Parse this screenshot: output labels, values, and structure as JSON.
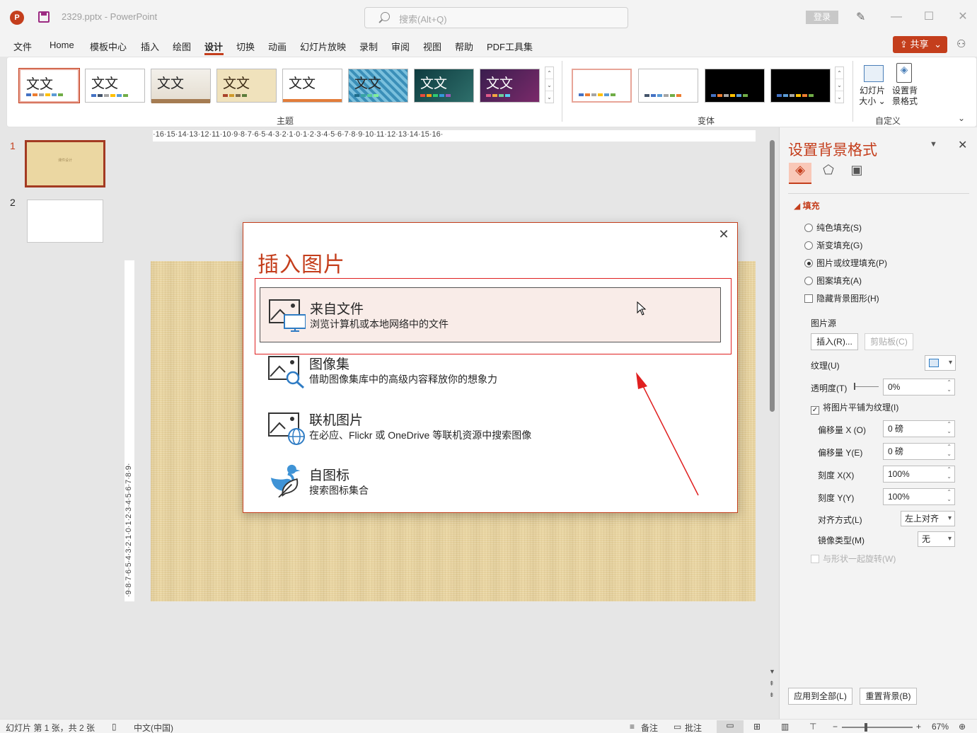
{
  "titlebar": {
    "file_title": "2329.pptx  -  PowerPoint",
    "search_placeholder": "搜索(Alt+Q)",
    "login_label": "登录",
    "minimize": "—",
    "maximize": "☐",
    "close": "✕"
  },
  "tabs": [
    "文件",
    "Home",
    "模板中心",
    "插入",
    "绘图",
    "设计",
    "切换",
    "动画",
    "幻灯片放映",
    "录制",
    "审阅",
    "视图",
    "帮助",
    "PDF工具集"
  ],
  "active_tab": "设计",
  "share_label": "共享",
  "ribbon": {
    "theme_sample_text": "文文",
    "themes_label": "主题",
    "variants_label": "变体",
    "customize_label": "自定义",
    "slide_size_label": "幻灯片\n大小 ⌄",
    "format_bg_label": "设置背\n景格式"
  },
  "slides_panel": {
    "slides": [
      {
        "number": "1",
        "thumb_text": "课件设计"
      },
      {
        "number": "2",
        "thumb_text": ""
      }
    ]
  },
  "rulers": {
    "horizontal": "·16·15·14·13·12·11·10·9·8·7·6·5·4·3·2·1·0·1·2·3·4·5·6·7·8·9·10·11·12·13·14·15·16·",
    "vertical": "·9·8·7·6·5·4·3·2·1·0·1·2·3·4·5·6·7·8·9·"
  },
  "dialog": {
    "title": "插入图片",
    "close": "✕",
    "options": [
      {
        "title": "来自文件",
        "desc": "浏览计算机或本地网络中的文件"
      },
      {
        "title": "图像集",
        "desc": "借助图像集库中的高级内容释放你的想象力"
      },
      {
        "title": "联机图片",
        "desc": "在必应、Flickr 或 OneDrive 等联机资源中搜索图像"
      },
      {
        "title": "自图标",
        "desc": "搜索图标集合"
      }
    ]
  },
  "format_pane": {
    "title": "设置背景格式",
    "fill_header": "填充",
    "radio_solid": "纯色填充(S)",
    "radio_gradient": "渐变填充(G)",
    "radio_picture": "图片或纹理填充(P)",
    "radio_pattern": "图案填充(A)",
    "check_hide": "隐藏背景图形(H)",
    "picture_source": "图片源",
    "insert_btn": "插入(R)...",
    "clipboard_btn": "剪贴板(C)",
    "texture_label": "纹理(U)",
    "transparency_label": "透明度(T)",
    "transparency_value": "0%",
    "tile_check": "将图片平铺为纹理(I)",
    "offset_x_label": "偏移量 X (O)",
    "offset_x_value": "0 磅",
    "offset_y_label": "偏移量 Y(E)",
    "offset_y_value": "0 磅",
    "scale_x_label": "刻度 X(X)",
    "scale_x_value": "100%",
    "scale_y_label": "刻度 Y(Y)",
    "scale_y_value": "100%",
    "align_label": "对齐方式(L)",
    "align_value": "左上对齐",
    "mirror_label": "镜像类型(M)",
    "mirror_value": "无",
    "rotate_check": "与形状一起旋转(W)",
    "apply_all_btn": "应用到全部(L)",
    "reset_btn": "重置背景(B)"
  },
  "statusbar": {
    "slide_info": "幻灯片 第 1 张，共 2 张",
    "language": "中文(中国)",
    "notes": "备注",
    "comments": "批注",
    "zoom": "67%"
  },
  "colors": {
    "accent": "#c43e1c",
    "highlight_red": "#e02020"
  }
}
